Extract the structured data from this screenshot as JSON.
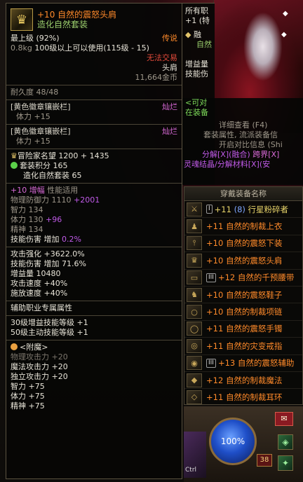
{
  "item": {
    "name": "+10 自然的震怒头肩",
    "set_name": "造化自然套装",
    "grade": "最上级",
    "grade_pct": "(92%)",
    "rarity": "传说",
    "weight": "0.8kg",
    "level_req": "100级以上可以使用(115级 - 15)",
    "trade": "无法交易",
    "slot": "头肩",
    "price": "11,664金币",
    "durability": "耐久度 48/48",
    "sockets": [
      {
        "name": "[黄色徽章镶嵌栏]",
        "grade": "灿烂",
        "stat": "体力 +15"
      },
      {
        "name": "[黄色徽章镶嵌栏]",
        "grade": "灿烂",
        "stat": "体力 +15"
      }
    ],
    "adventure_fame": "冒险家名望 1200 + 1435",
    "set_points": "套装积分 165",
    "set_points_sub": "造化自然套装 65",
    "amplify_label": "+10 增幅",
    "amplify_note": "性能适用",
    "phys_def_label": "物理防御力 1110",
    "phys_def_bonus": "+2001",
    "int": "智力 134",
    "vit_label": "体力 130",
    "vit_bonus": "+96",
    "spi": "精神 134",
    "skill_dmg_label": "技能伤害 增加",
    "skill_dmg_val": "0.2%",
    "atk_boost": "攻击强化 +3622.0%",
    "skill_dmg2": "技能伤害 增加 71.6%",
    "buff_power": "增益量 10480",
    "atk_speed": "攻击速度 +40%",
    "cast_speed": "施放速度 +40%",
    "support_header": "辅助职业专属属性",
    "support_1": "30级增益技能等级 +1",
    "support_2": "50级主动技能等级 +1",
    "enchant_title": "<附魔>",
    "enchant_lines": [
      {
        "text": "物理攻击力 +20",
        "dim": true
      },
      {
        "text": "魔法攻击力 +20",
        "dim": false
      },
      {
        "text": "独立攻击力 +20",
        "dim": false
      },
      {
        "text": "智力 +75",
        "dim": false
      },
      {
        "text": "体力 +75",
        "dim": false
      },
      {
        "text": "精神 +75",
        "dim": false
      }
    ]
  },
  "mid_panel": {
    "line1": "所有职",
    "line2": "+1 (特",
    "line3": "融",
    "line4": "自然",
    "line5": "增益量",
    "line6": "技能伤",
    "line7": "<可对",
    "line8": "在装备",
    "line9": "详细查看 (F4)",
    "line10": "套装属性, 流派装备信",
    "line11": "开启对比信息 (Shi",
    "line12a": "分解[X](融合)",
    "line12b": "跨界[X]",
    "line13": "灵魂结晶/分解材料[X](安"
  },
  "equip_panel": {
    "title": "穿戴装备名称",
    "rows": [
      {
        "badge": "I",
        "level": "+11",
        "extra": "(8)",
        "name": "行星粉碎者",
        "color": "#e8d46a"
      },
      {
        "badge": "",
        "level": "+11",
        "extra": "",
        "name": "自然的制裁上衣",
        "color": "#ff8a2a"
      },
      {
        "badge": "",
        "level": "+10",
        "extra": "",
        "name": "自然的震怒下装",
        "color": "#ff8a2a"
      },
      {
        "badge": "",
        "level": "+10",
        "extra": "",
        "name": "自然的震怒头肩",
        "color": "#ff8a2a"
      },
      {
        "badge": "III",
        "level": "+12",
        "extra": "",
        "name": "自然的千预腰带",
        "color": "#ff8a2a"
      },
      {
        "badge": "",
        "level": "+10",
        "extra": "",
        "name": "自然的震怒鞋子",
        "color": "#ff8a2a"
      },
      {
        "badge": "",
        "level": "+10",
        "extra": "",
        "name": "自然的制裁项链",
        "color": "#ff8a2a"
      },
      {
        "badge": "",
        "level": "+11",
        "extra": "",
        "name": "自然的震怒手镯",
        "color": "#ff8a2a"
      },
      {
        "badge": "",
        "level": "+11",
        "extra": "",
        "name": "自然的灾变戒指",
        "color": "#ff8a2a"
      },
      {
        "badge": "III",
        "level": "+13",
        "extra": "",
        "name": "自然的震怒辅助",
        "color": "#ff8a2a"
      },
      {
        "badge": "",
        "level": "+12",
        "extra": "",
        "name": "自然的制裁魔法",
        "color": "#ff8a2a"
      },
      {
        "badge": "",
        "level": "+11",
        "extra": "",
        "name": "自然的制裁耳环",
        "color": "#ff8a2a"
      }
    ]
  },
  "hud": {
    "mp": "100%",
    "level": "38",
    "ctrl_label": "Ctrl"
  },
  "colors": {
    "legendary": "#ff8a2a",
    "set": "#9dd06e",
    "bonus": "#c05ae8"
  }
}
